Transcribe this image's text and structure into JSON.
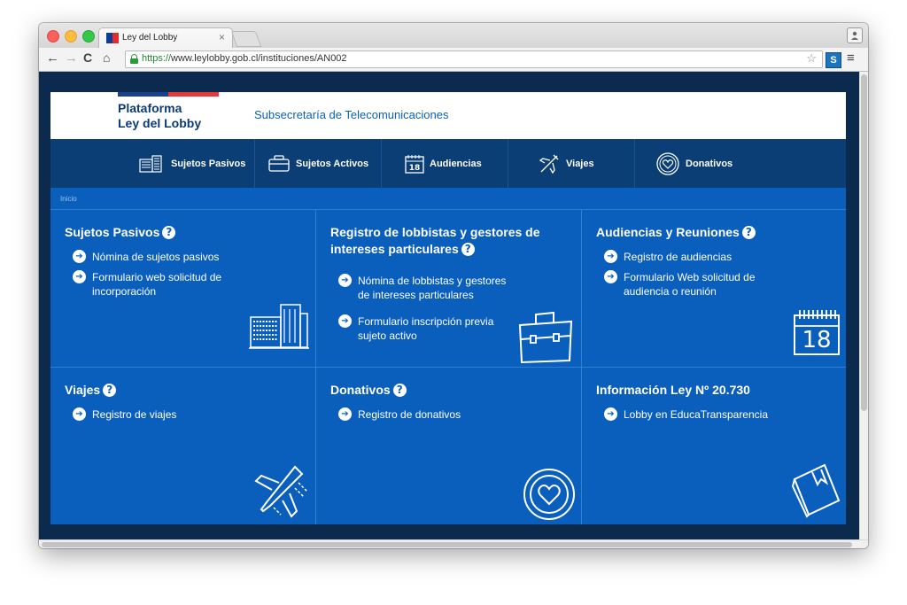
{
  "browser": {
    "tab_title": "Ley del Lobby",
    "tab_close": "×",
    "url_https": "https://",
    "url_rest": "www.leylobby.gob.cl/instituciones/AN002",
    "ext_label": "S"
  },
  "header": {
    "brand_line1": "Plataforma",
    "brand_line2": "Ley del Lobby",
    "subtitle": "Subsecretaría de Telecomunicaciones"
  },
  "nav": [
    {
      "label": "Sujetos Pasivos",
      "icon": "building-icon"
    },
    {
      "label": "Sujetos Activos",
      "icon": "briefcase-icon"
    },
    {
      "label": "Audiencias",
      "icon": "calendar-icon"
    },
    {
      "label": "Viajes",
      "icon": "airplane-icon"
    },
    {
      "label": "Donativos",
      "icon": "heart-icon"
    }
  ],
  "breadcrumb": "Inicio",
  "cards": [
    {
      "title": "Sujetos Pasivos",
      "links": [
        "Nómina de sujetos pasivos",
        "Formulario web solicitud de\nincorporación"
      ]
    },
    {
      "title": "Registro de lobbistas y gestores de\nintereses particulares",
      "links": [
        "Nómina de lobbistas y gestores\nde intereses particulares",
        "Formulario inscripción previa\nsujeto activo"
      ]
    },
    {
      "title": "Audiencias y Reuniones",
      "links": [
        "Registro de audiencias",
        "Formulario Web solicitud de\naudiencia o reunión"
      ],
      "calendar_number": "18"
    },
    {
      "title": "Viajes",
      "links": [
        "Registro de viajes"
      ]
    },
    {
      "title": "Donativos",
      "links": [
        "Registro de donativos"
      ]
    },
    {
      "title": "Información Ley Nº 20.730",
      "links": [
        "Lobby en EducaTransparencia"
      ]
    }
  ],
  "glyphs": {
    "help": "?",
    "arrow": "➔"
  },
  "colors": {
    "site_blue": "#0a5fbd",
    "nav_blue": "#0b3e75",
    "page_dark": "#0b2a4e"
  }
}
